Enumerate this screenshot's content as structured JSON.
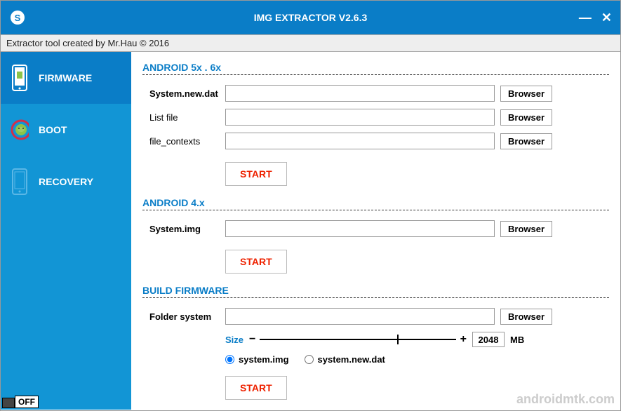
{
  "titlebar": {
    "title": "IMG EXTRACTOR V2.6.3"
  },
  "subheader": "Extractor tool created by Mr.Hau © 2016",
  "sidebar": {
    "items": [
      {
        "label": "FIRMWARE"
      },
      {
        "label": "BOOT"
      },
      {
        "label": "RECOVERY"
      }
    ],
    "toggle": "OFF"
  },
  "sections": {
    "android56": {
      "title": "ANDROID 5x . 6x",
      "fields": [
        {
          "label": "System.new.dat",
          "bold": true
        },
        {
          "label": "List file",
          "bold": false
        },
        {
          "label": "file_contexts",
          "bold": false
        }
      ]
    },
    "android4": {
      "title": "ANDROID 4.x",
      "fields": [
        {
          "label": "System.img",
          "bold": true
        }
      ]
    },
    "build": {
      "title": "BUILD FIRMWARE",
      "fields": [
        {
          "label": "Folder system",
          "bold": true
        }
      ],
      "size_label": "Size",
      "size_value": "2048",
      "size_unit": "MB",
      "radio1": "system.img",
      "radio2": "system.new.dat"
    }
  },
  "buttons": {
    "browser": "Browser",
    "start": "START"
  },
  "watermark": "androidmtk.com"
}
